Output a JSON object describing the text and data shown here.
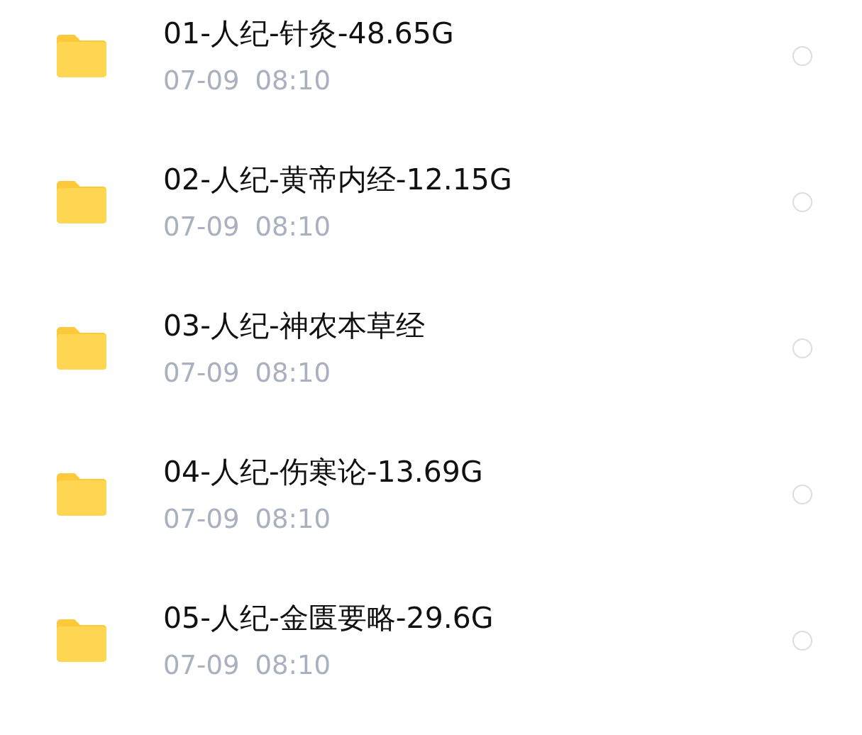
{
  "files": [
    {
      "name": "01-人纪-针灸-48.65G",
      "date": "07-09",
      "time": "08:10",
      "selected": false
    },
    {
      "name": "02-人纪-黄帝内经-12.15G",
      "date": "07-09",
      "time": "08:10",
      "selected": false
    },
    {
      "name": "03-人纪-神农本草经",
      "date": "07-09",
      "time": "08:10",
      "selected": false
    },
    {
      "name": "04-人纪-伤寒论-13.69G",
      "date": "07-09",
      "time": "08:10",
      "selected": false
    },
    {
      "name": "05-人纪-金匮要略-29.6G",
      "date": "07-09",
      "time": "08:10",
      "selected": false
    }
  ]
}
